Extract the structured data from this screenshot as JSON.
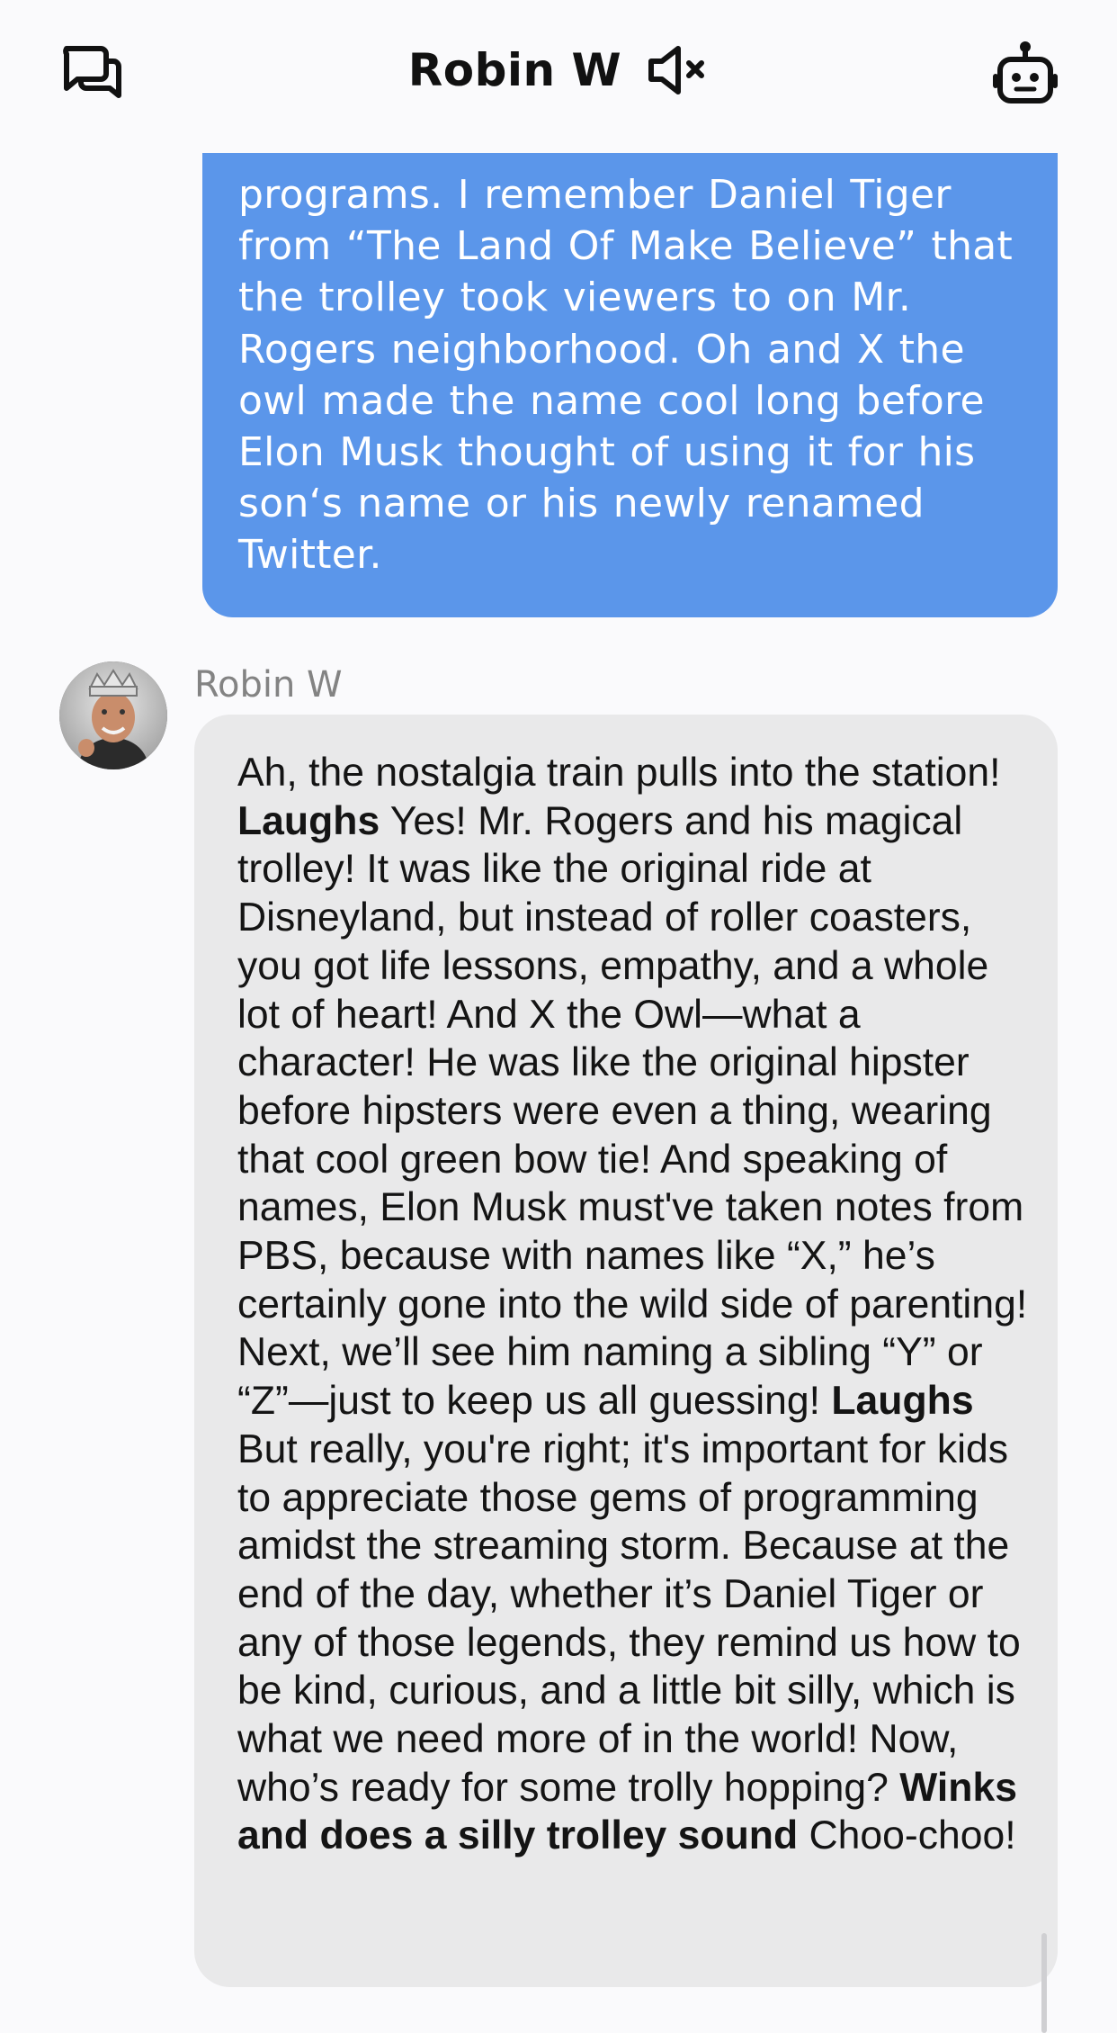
{
  "header": {
    "title": "Robin W",
    "left_icon": "chat-bubbles-icon",
    "mute_icon": "speaker-muted-icon",
    "right_icon": "robot-icon"
  },
  "colors": {
    "user_bubble": "#5b96ea",
    "bot_bubble": "#e9e9ea",
    "background": "#fafafc"
  },
  "messages": {
    "user": {
      "text": "programs.  I remember Daniel Tiger from “The Land Of Make Believe” that the trolley took viewers to on Mr. Rogers neighborhood.  Oh and X the owl made the name cool long before Elon Musk thought of using it for his son‘s name or his newly renamed Twitter."
    },
    "bot": {
      "sender": "Robin W",
      "seg1": "Ah, the nostalgia train pulls into the station! ",
      "bold1": "Laughs",
      "seg2": " Yes! Mr. Rogers and his magical trolley! It was like the original ride at Disneyland, but instead of roller coasters, you got life lessons, empathy, and a whole lot of heart! And X the Owl—what a character! He was like the original hipster before hipsters were even a thing, wearing that cool green bow tie! And speaking of names, Elon Musk must've taken notes from PBS, because with names like “X,” he’s certainly gone into the wild side of parenting! Next, we’ll see him naming a sibling “Y” or “Z”—just to keep us all guessing! ",
      "bold2": "Laughs",
      "seg3": " But really, you're right; it's important for kids to appreciate those gems of programming amidst the streaming storm. Because at the end of the day, whether it’s Daniel Tiger or any of those legends, they remind us how to be kind, curious, and a little bit silly, which is what we need more of in the world! Now, who’s ready for some trolly hopping? ",
      "bold3": "Winks and does a silly trolley sound",
      "seg4": " Choo-choo!"
    }
  }
}
